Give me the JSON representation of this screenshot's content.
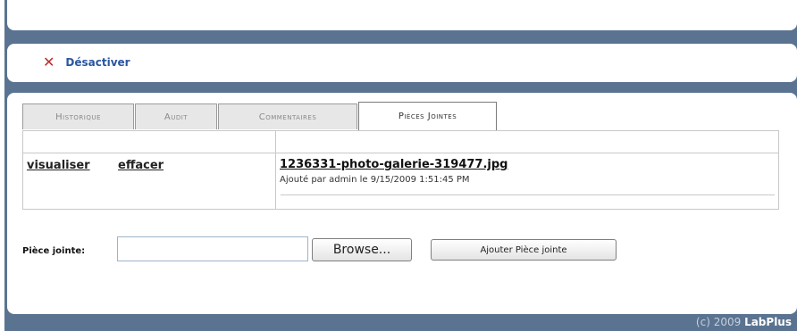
{
  "toolbar": {
    "deactivate_label": "Désactiver",
    "deactivate_icon": "close-icon"
  },
  "tabs": [
    {
      "label": "Historique",
      "active": false
    },
    {
      "label": "Audit",
      "active": false
    },
    {
      "label": "Commentaires",
      "active": false
    },
    {
      "label": "Pièces Jointes",
      "active": true
    }
  ],
  "attachments": {
    "rows": [
      {
        "view_label": "visualiser",
        "delete_label": "effacer",
        "file_name": "1236331-photo-galerie-319477.jpg",
        "meta": "Ajouté par admin le 9/15/2009 1:51:45 PM"
      }
    ]
  },
  "form": {
    "attachment_label": "Pièce jointe:",
    "attachment_value": "",
    "browse_label": "Browse...",
    "add_label": "Ajouter Pièce jointe"
  },
  "footer": {
    "copyright_prefix": "(c) 2009 ",
    "brand": "LabPlus"
  },
  "colors": {
    "frame": "#5a7391",
    "link_blue": "#2b56a0",
    "close_red": "#c02a2a"
  }
}
